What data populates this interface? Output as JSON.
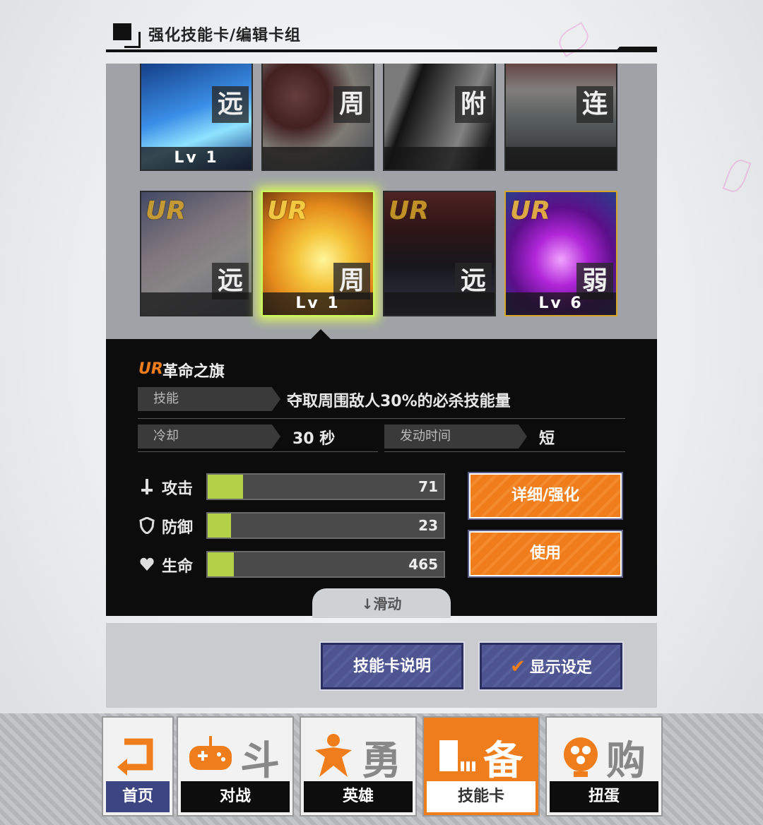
{
  "header": {
    "title": "强化技能卡/编辑卡组"
  },
  "cards_row1": [
    {
      "lv": "Lv 1",
      "type": "远"
    },
    {
      "lv": "",
      "type": "周"
    },
    {
      "lv": "",
      "type": "附"
    },
    {
      "lv": "",
      "type": "连"
    }
  ],
  "cards_row2": [
    {
      "rarity": "UR",
      "lv": "",
      "type": "远"
    },
    {
      "rarity": "UR",
      "lv": "Lv 1",
      "type": "周"
    },
    {
      "rarity": "UR",
      "lv": "",
      "type": "远"
    },
    {
      "rarity": "UR",
      "lv": "Lv 6",
      "type": "弱"
    }
  ],
  "detail": {
    "rarity": "UR",
    "name": "革命之旗",
    "skill_label": "技能",
    "skill_text": "夺取周围敌人30%的必杀技能量",
    "cooldown_label": "冷却",
    "cooldown_value": "30 秒",
    "activation_label": "发动时间",
    "activation_value": "短",
    "stats": [
      {
        "label": "攻击",
        "value": "71",
        "fill": 0.15,
        "icon": "sword-icon"
      },
      {
        "label": "防御",
        "value": "23",
        "fill": 0.1,
        "icon": "shield-icon"
      },
      {
        "label": "生命",
        "value": "465",
        "fill": 0.11,
        "icon": "heart-icon"
      }
    ],
    "detail_button": "详细/强化",
    "use_button": "使用",
    "scroll_hint": "↓滑动"
  },
  "lower": {
    "info_button": "技能卡说明",
    "display_button": "显示设定"
  },
  "nav": [
    {
      "label": "首页",
      "icon": "back-arrow-icon"
    },
    {
      "label": "对战",
      "icon": "gamepad-icon",
      "glyph": "斗"
    },
    {
      "label": "英雄",
      "icon": "hero-icon",
      "glyph": "勇"
    },
    {
      "label": "技能卡",
      "icon": "cards-icon",
      "glyph": "备"
    },
    {
      "label": "扭蛋",
      "icon": "gacha-icon",
      "glyph": "购"
    }
  ],
  "colors": {
    "accent": "#f07d1b",
    "bar_fill": "#b5d049",
    "blue_button": "#4d5490"
  }
}
